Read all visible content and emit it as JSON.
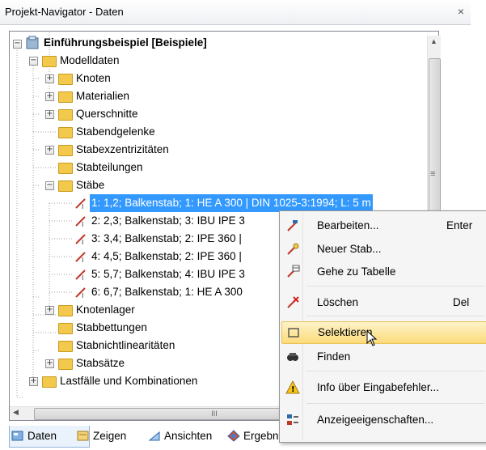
{
  "window": {
    "title": "Projekt-Navigator - Daten",
    "close_glyph": "×"
  },
  "tree": {
    "root": "Einführungsbeispiel [Beispiele]",
    "modelldaten": "Modelldaten",
    "knoten": "Knoten",
    "materialien": "Materialien",
    "querschnitte": "Querschnitte",
    "stabendgelenke": "Stabendgelenke",
    "stabexzentrizitaeten": "Stabexzentrizitäten",
    "stabteilungen": "Stabteilungen",
    "staebe": "Stäbe",
    "members": [
      "1: 1,2; Balkenstab; 1: HE A 300 | DIN 1025-3:1994; L: 5 m",
      "2: 2,3; Balkenstab; 3: IBU IPE 3",
      "3: 3,4; Balkenstab; 2: IPE 360 |",
      "4: 4,5; Balkenstab; 2: IPE 360 |",
      "5: 5,7; Balkenstab; 4: IBU IPE 3",
      "6: 6,7; Balkenstab; 1: HE A 300"
    ],
    "knotenlager": "Knotenlager",
    "stabbettungen": "Stabbettungen",
    "stabnichtlinearitaeten": "Stabnichtlinearitäten",
    "stabsaetze": "Stabsätze",
    "lastfaelle": "Lastfälle und Kombinationen",
    "hscroll_grip": "III",
    "vscroll_grip": "≡"
  },
  "tabs": [
    "Daten",
    "Zeigen",
    "Ansichten",
    "Ergebnisse"
  ],
  "context_menu": {
    "items": [
      {
        "label": "Bearbeiten...",
        "shortcut": "Enter",
        "icon": "edit-member-icon"
      },
      {
        "label": "Neuer Stab...",
        "shortcut": "",
        "icon": "new-member-icon"
      },
      {
        "label": "Gehe zu Tabelle",
        "shortcut": "",
        "icon": "go-to-table-icon"
      },
      {
        "label": "Löschen",
        "shortcut": "Del",
        "icon": "delete-icon"
      },
      {
        "label": "Selektieren",
        "shortcut": "",
        "icon": "select-icon",
        "highlighted": true
      },
      {
        "label": "Finden",
        "shortcut": "",
        "icon": "find-icon"
      },
      {
        "label": "Info über Eingabefehler...",
        "shortcut": "",
        "icon": "warning-icon"
      },
      {
        "label": "Anzeigeeigenschaften...",
        "shortcut": "",
        "icon": "display-properties-icon"
      }
    ]
  },
  "colors": {
    "selection": "#3399ff",
    "folder": "#f2c94c",
    "menu_highlight": "#fcdb7a"
  }
}
